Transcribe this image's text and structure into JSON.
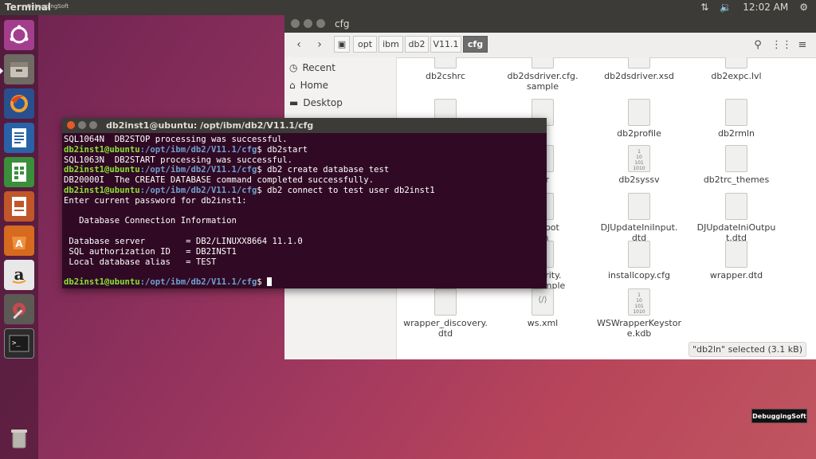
{
  "topbar": {
    "title": "Terminal",
    "watermark": "DebuggingSoft",
    "clock": "12:02 AM"
  },
  "launcher": {
    "items": [
      "ubuntu-icon",
      "files-icon",
      "firefox-icon",
      "writer-icon",
      "calc-icon",
      "impress-icon",
      "software-center-icon",
      "amazon-icon",
      "settings-icon",
      "terminal-icon",
      "trash-icon"
    ]
  },
  "file_manager": {
    "title": "cfg",
    "breadcrumbs": [
      "opt",
      "ibm",
      "db2",
      "V11.1",
      "cfg"
    ],
    "sidebar": [
      "Recent",
      "Home",
      "Desktop"
    ],
    "files": [
      {
        "name": "db2cshrc",
        "kind": "doc"
      },
      {
        "name": "db2dsdriver.cfg.\nsample",
        "kind": "doc"
      },
      {
        "name": "db2dsdriver.xsd",
        "kind": "xml"
      },
      {
        "name": "db2expc.lvl",
        "kind": "doc"
      },
      {
        "name": "",
        "kind": "doc"
      },
      {
        "name": "n",
        "kind": "doc"
      },
      {
        "name": "db2profile",
        "kind": "doc"
      },
      {
        "name": "db2rmln",
        "kind": "doc"
      },
      {
        "name": "",
        "kind": "doc"
      },
      {
        "name": "ssr",
        "kind": "doc"
      },
      {
        "name": "db2syssv",
        "kind": "bin"
      },
      {
        "name": "db2trc_themes",
        "kind": "doc"
      },
      {
        "name": "",
        "kind": "doc"
      },
      {
        "name": "balRoot\nrm",
        "kind": "doc"
      },
      {
        "name": "DJUpdateIniInput.\ndtd",
        "kind": "doc"
      },
      {
        "name": "DJUpdateIniOutpu\nt.dtd",
        "kind": "doc"
      },
      {
        "name": "",
        "kind": "doc"
      },
      {
        "name": "Security.\nini.sample",
        "kind": "doc"
      },
      {
        "name": "installcopy.cfg",
        "kind": "doc"
      },
      {
        "name": "wrapper.dtd",
        "kind": "doc"
      },
      {
        "name": "wrapper_discovery.\ndtd",
        "kind": "doc"
      },
      {
        "name": "ws.xml",
        "kind": "xml"
      },
      {
        "name": "WSWrapperKeystor\ne.kdb",
        "kind": "bin"
      }
    ],
    "status": "\"db2ln\" selected (3.1 kB)"
  },
  "terminal": {
    "title": "db2inst1@ubuntu: /opt/ibm/db2/V11.1/cfg",
    "prompt_user": "db2inst1@ubuntu",
    "prompt_path": ":/opt/ibm/db2/V11.1/cfg",
    "line1": "SQL1064N  DB2STOP processing was successful.",
    "cmd1": "$ db2start",
    "line2": "SQL1063N  DB2START processing was successful.",
    "cmd2": "$ db2 create database test",
    "line3": "DB20000I  The CREATE DATABASE command completed successfully.",
    "cmd3": "$ db2 connect to test user db2inst1",
    "line4": "Enter current password for db2inst1:",
    "line5": "",
    "line6": "   Database Connection Information",
    "line7": "",
    "line8": " Database server        = DB2/LINUXX8664 11.1.0",
    "line9": " SQL authorization ID   = DB2INST1",
    "line10": " Local database alias   = TEST",
    "line11": "",
    "cmd4": "$ "
  },
  "watermark_br": "DebuggingSoft"
}
